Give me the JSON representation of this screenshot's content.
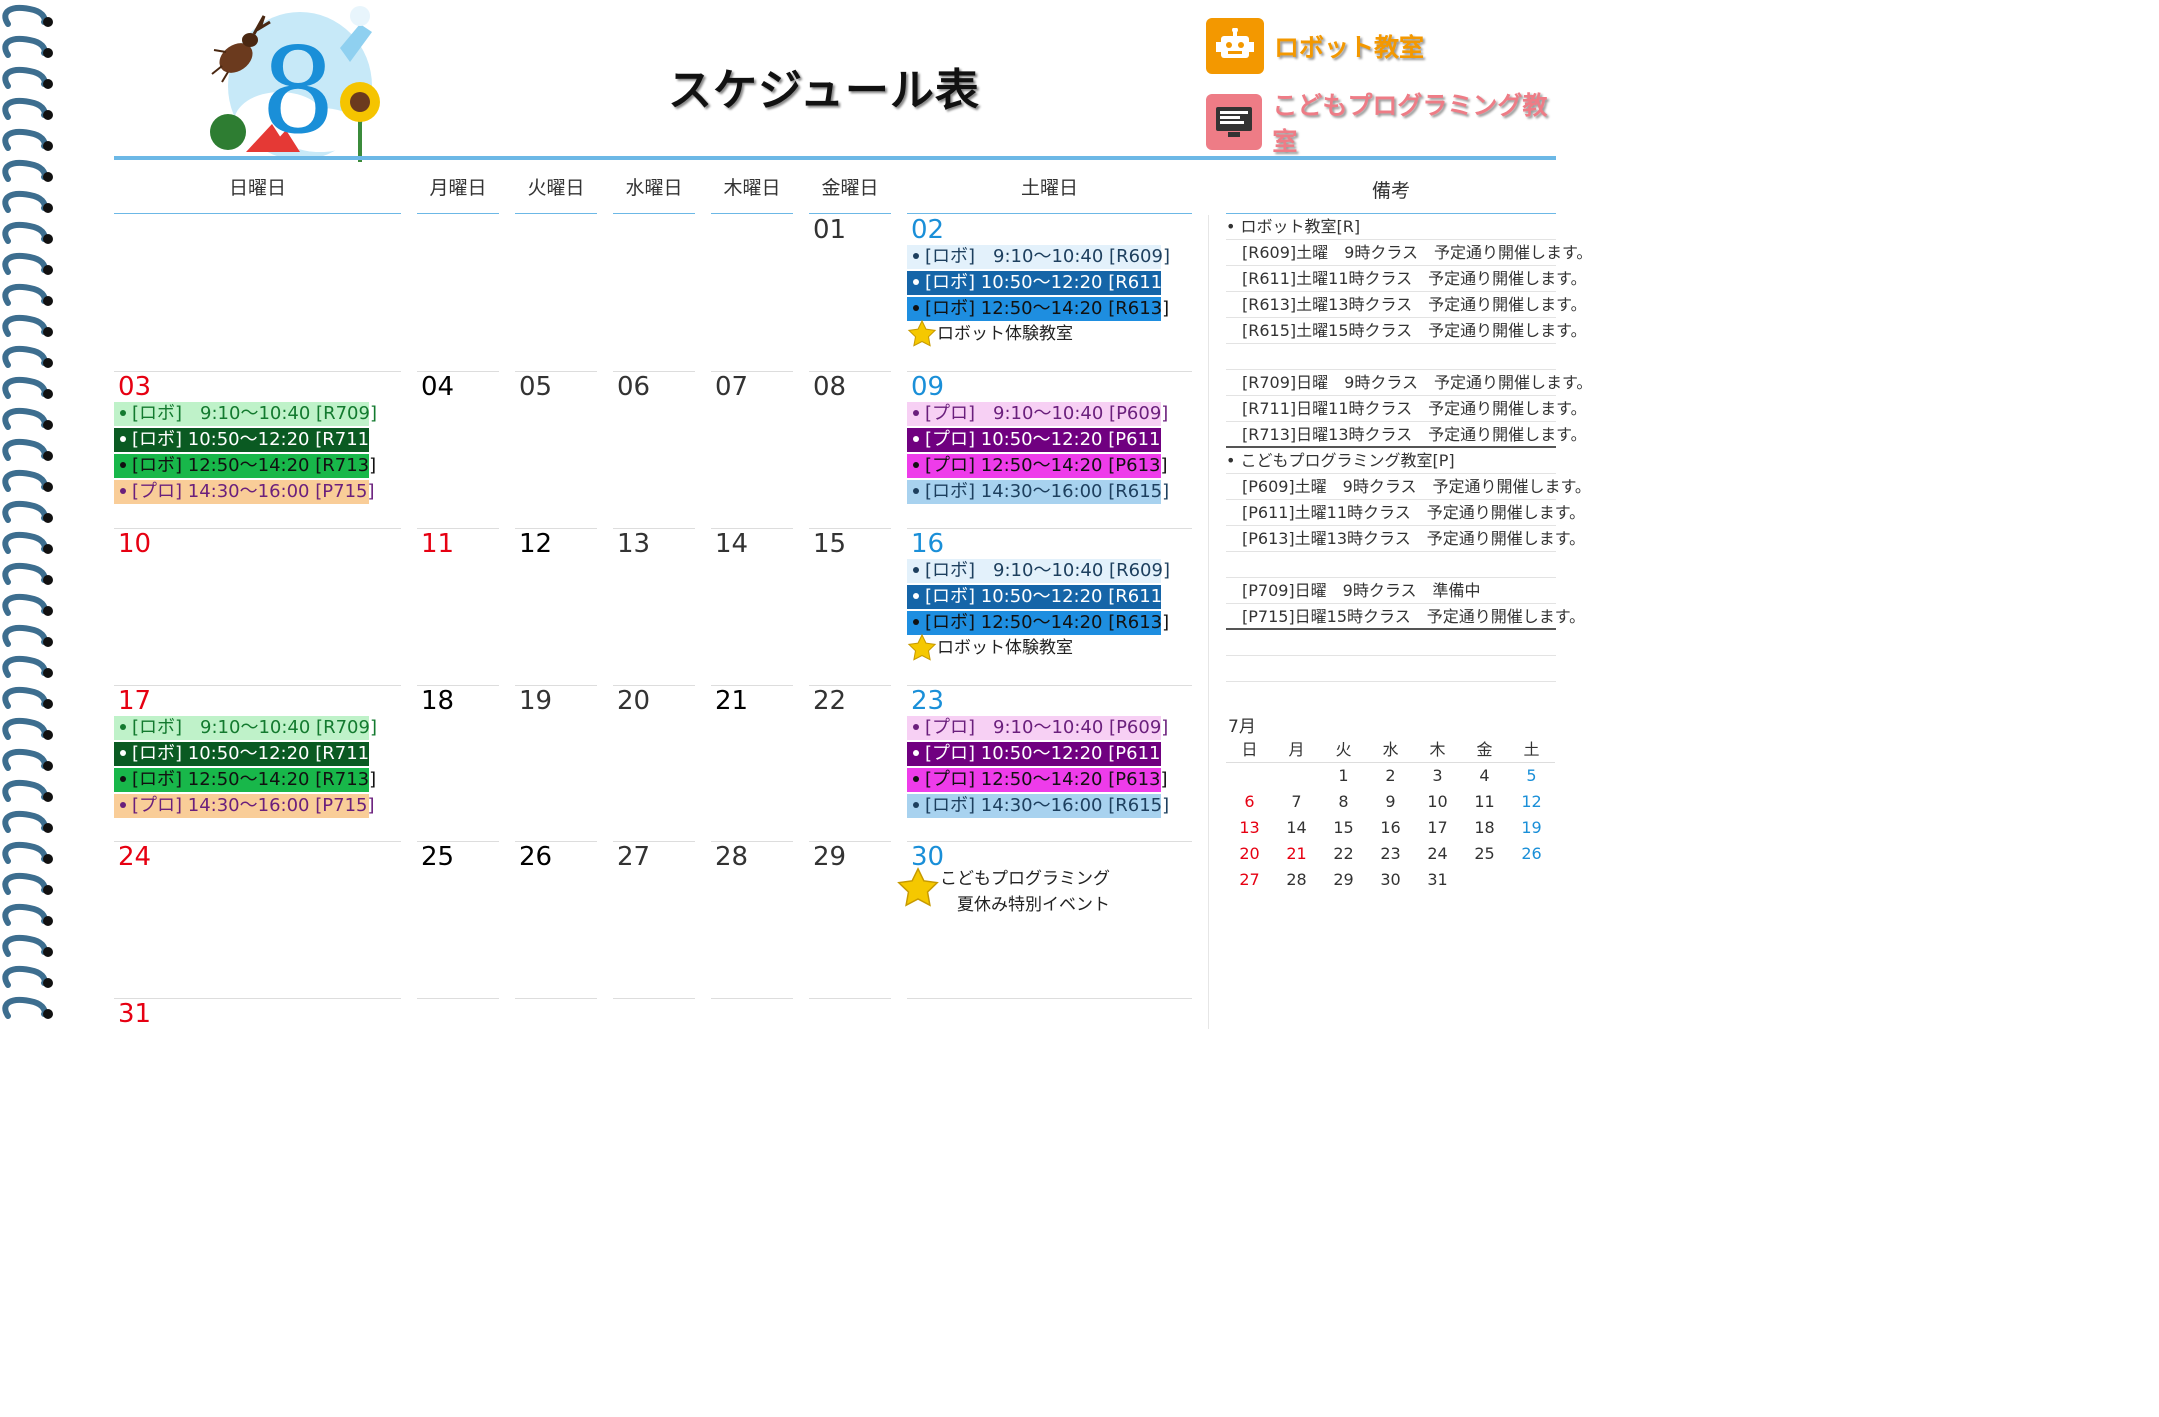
{
  "header": {
    "month_number": "8",
    "title": "スケジュール表",
    "legend_robot": "ロボット教室",
    "legend_prog": "こどもプログラミング教室"
  },
  "colors": {
    "accent_blue": "#6cb8e6",
    "sunday_red": "#e60012",
    "saturday_blue": "#1a8fd8",
    "robot_orange": "#f39800",
    "prog_pink": "#ee7c86"
  },
  "day_names": [
    "日曜日",
    "月曜日",
    "火曜日",
    "水曜日",
    "木曜日",
    "金曜日",
    "土曜日"
  ],
  "weeks": [
    {
      "dates": [
        "",
        "",
        "",
        "",
        "",
        "01",
        "02"
      ],
      "sun_events": [],
      "sat_events": [
        {
          "text": "[ロボ]　9:10～10:40 [R609]",
          "bg": "#e3f1fb",
          "fg": "#1d3f5e",
          "dot": "#1d3f5e"
        },
        {
          "text": "[ロボ] 10:50～12:20 [R611]",
          "bg": "#1565a8",
          "fg": "#ffffff",
          "dot": "#ffffff"
        },
        {
          "text": "[ロボ] 12:50～14:20 [R613]",
          "bg": "#1e8ee0",
          "fg": "#111111",
          "dot": "#111111"
        }
      ],
      "sat_note": [
        "ロボット体験教室"
      ]
    },
    {
      "dates": [
        "03",
        "04",
        "05",
        "06",
        "07",
        "08",
        "09"
      ],
      "sun_events": [
        {
          "text": "[ロボ]　9:10～10:40 [R709]",
          "bg": "#bff2c9",
          "fg": "#137a2f",
          "dot": "#137a2f"
        },
        {
          "text": "[ロボ] 10:50～12:20 [R711]",
          "bg": "#0a5a22",
          "fg": "#ffffff",
          "dot": "#ffffff"
        },
        {
          "text": "[ロボ] 12:50～14:20 [R713]",
          "bg": "#18b74a",
          "fg": "#111111",
          "dot": "#111111"
        },
        {
          "text": "[プロ] 14:30～16:00 [P715]",
          "bg": "#f9cd98",
          "fg": "#6a1f7c",
          "dot": "#6a1f7c"
        }
      ],
      "sat_events": [
        {
          "text": "[プロ]　9:10～10:40 [P609]",
          "bg": "#f7d0f4",
          "fg": "#6a1f7c",
          "dot": "#6a1f7c"
        },
        {
          "text": "[プロ] 10:50～12:20 [P611]",
          "bg": "#700080",
          "fg": "#ffffff",
          "dot": "#ffffff"
        },
        {
          "text": "[プロ] 12:50～14:20 [P613]",
          "bg": "#ee3cea",
          "fg": "#111111",
          "dot": "#111111"
        },
        {
          "text": "[ロボ] 14:30～16:00 [R615]",
          "bg": "#a8d2ef",
          "fg": "#1d3f5e",
          "dot": "#1d3f5e"
        }
      ],
      "sat_note": []
    },
    {
      "dates": [
        "10",
        "11",
        "12",
        "13",
        "14",
        "15",
        "16"
      ],
      "sun_events": [],
      "sat_events": [
        {
          "text": "[ロボ]　9:10～10:40 [R609]",
          "bg": "#e3f1fb",
          "fg": "#1d3f5e",
          "dot": "#1d3f5e"
        },
        {
          "text": "[ロボ] 10:50～12:20 [R611]",
          "bg": "#1565a8",
          "fg": "#ffffff",
          "dot": "#ffffff"
        },
        {
          "text": "[ロボ] 12:50～14:20 [R613]",
          "bg": "#1e8ee0",
          "fg": "#111111",
          "dot": "#111111"
        }
      ],
      "sat_note": [
        "ロボット体験教室"
      ]
    },
    {
      "dates": [
        "17",
        "18",
        "19",
        "20",
        "21",
        "22",
        "23"
      ],
      "sun_events": [
        {
          "text": "[ロボ]　9:10～10:40 [R709]",
          "bg": "#bff2c9",
          "fg": "#137a2f",
          "dot": "#137a2f"
        },
        {
          "text": "[ロボ] 10:50～12:20 [R711]",
          "bg": "#0a5a22",
          "fg": "#ffffff",
          "dot": "#ffffff"
        },
        {
          "text": "[ロボ] 12:50～14:20 [R713]",
          "bg": "#18b74a",
          "fg": "#111111",
          "dot": "#111111"
        },
        {
          "text": "[プロ] 14:30～16:00 [P715]",
          "bg": "#f9cd98",
          "fg": "#6a1f7c",
          "dot": "#6a1f7c"
        }
      ],
      "sat_events": [
        {
          "text": "[プロ]　9:10～10:40 [P609]",
          "bg": "#f7d0f4",
          "fg": "#6a1f7c",
          "dot": "#6a1f7c"
        },
        {
          "text": "[プロ] 10:50～12:20 [P611]",
          "bg": "#700080",
          "fg": "#ffffff",
          "dot": "#ffffff"
        },
        {
          "text": "[プロ] 12:50～14:20 [P613]",
          "bg": "#ee3cea",
          "fg": "#111111",
          "dot": "#111111"
        },
        {
          "text": "[ロボ] 14:30～16:00 [R615]",
          "bg": "#a8d2ef",
          "fg": "#1d3f5e",
          "dot": "#1d3f5e"
        }
      ],
      "sat_note": []
    },
    {
      "dates": [
        "24",
        "25",
        "26",
        "27",
        "28",
        "29",
        "30"
      ],
      "sun_events": [],
      "sat_events": [],
      "sat_note": [
        "こどもプログラミング",
        "　夏休み特別イベント"
      ]
    },
    {
      "dates": [
        "31",
        "",
        "",
        "",
        "",
        "",
        ""
      ],
      "sun_events": [],
      "sat_events": [],
      "sat_note": []
    }
  ],
  "notes": {
    "heading": "備考",
    "rows": [
      {
        "text": "• ロボット教室[R]",
        "style": "cat"
      },
      {
        "text": "　[R609]土曜　9時クラス　予定通り開催します。",
        "style": ""
      },
      {
        "text": "　[R611]土曜11時クラス　予定通り開催します。",
        "style": ""
      },
      {
        "text": "　[R613]土曜13時クラス　予定通り開催します。",
        "style": ""
      },
      {
        "text": "　[R615]土曜15時クラス　予定通り開催します。",
        "style": ""
      },
      {
        "text": "",
        "style": ""
      },
      {
        "text": "　[R709]日曜　9時クラス　予定通り開催します。",
        "style": ""
      },
      {
        "text": "　[R711]日曜11時クラス　予定通り開催します。",
        "style": ""
      },
      {
        "text": "　[R713]日曜13時クラス　予定通り開催します。",
        "style": "strong"
      },
      {
        "text": "• こどもプログラミング教室[P]",
        "style": "cat"
      },
      {
        "text": "　[P609]土曜　9時クラス　予定通り開催します。",
        "style": ""
      },
      {
        "text": "　[P611]土曜11時クラス　予定通り開催します。",
        "style": ""
      },
      {
        "text": "　[P613]土曜13時クラス　予定通り開催します。",
        "style": ""
      },
      {
        "text": "",
        "style": ""
      },
      {
        "text": "　[P709]日曜　9時クラス　準備中",
        "style": ""
      },
      {
        "text": "　[P715]日曜15時クラス　予定通り開催します。",
        "style": "strong"
      },
      {
        "text": "",
        "style": ""
      },
      {
        "text": "",
        "style": ""
      }
    ]
  },
  "mini_calendar": {
    "title": "7月",
    "headers": [
      "日",
      "月",
      "火",
      "水",
      "木",
      "金",
      "土"
    ],
    "weeks": [
      [
        "",
        "",
        "1",
        "2",
        "3",
        "4",
        "5"
      ],
      [
        "6",
        "7",
        "8",
        "9",
        "10",
        "11",
        "12"
      ],
      [
        "13",
        "14",
        "15",
        "16",
        "17",
        "18",
        "19"
      ],
      [
        "20",
        "21",
        "22",
        "23",
        "24",
        "25",
        "26"
      ],
      [
        "27",
        "28",
        "29",
        "30",
        "31",
        "",
        ""
      ]
    ],
    "holidays": [
      "21"
    ]
  }
}
